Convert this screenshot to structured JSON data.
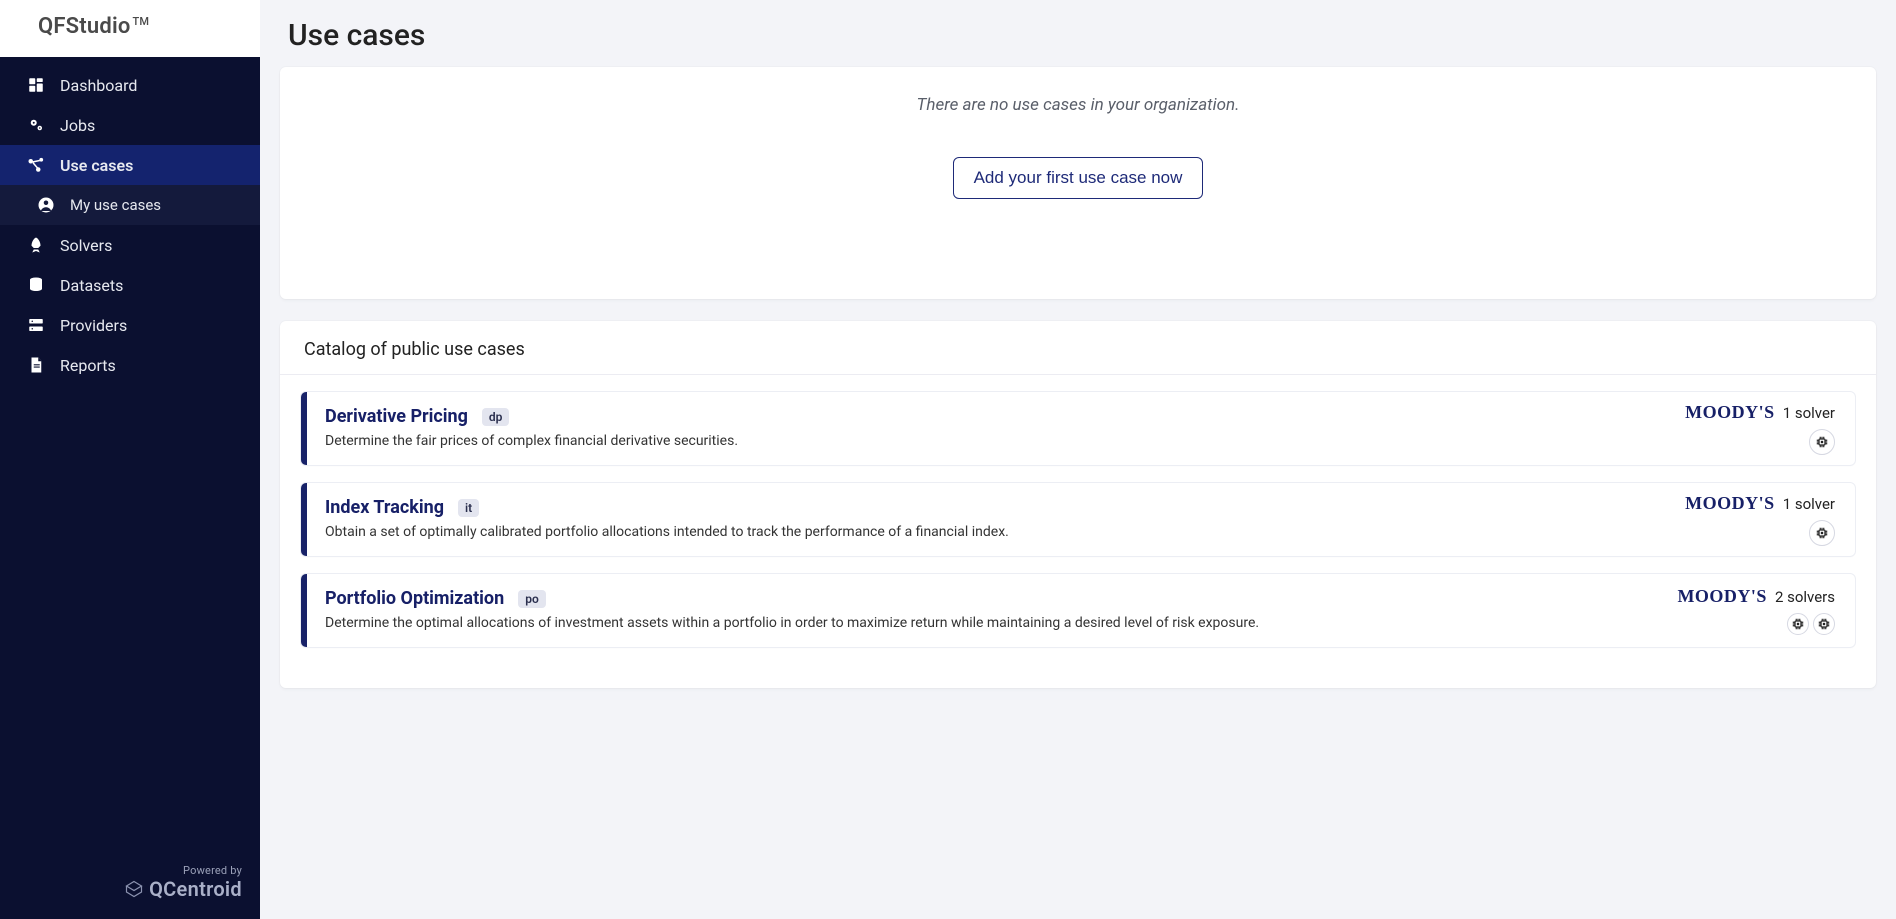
{
  "brand": {
    "name": "QFStudio",
    "tm": "TM"
  },
  "sidebar": {
    "items": [
      {
        "label": "Dashboard"
      },
      {
        "label": "Jobs"
      },
      {
        "label": "Use cases"
      },
      {
        "label": "Solvers"
      },
      {
        "label": "Datasets"
      },
      {
        "label": "Providers"
      },
      {
        "label": "Reports"
      }
    ],
    "sub": {
      "my_use_cases": "My use cases"
    }
  },
  "footer": {
    "powered": "Powered by",
    "brand": "QCentroid"
  },
  "page_title": "Use cases",
  "empty_card": {
    "message": "There are no use cases in your organization.",
    "button": "Add your first use case now"
  },
  "catalog": {
    "title": "Catalog of public use cases",
    "items": [
      {
        "title": "Derivative Pricing",
        "tag": "dp",
        "desc": "Determine the fair prices of complex financial derivative securities.",
        "provider": "MOODY'S",
        "solvers_label": "1 solver",
        "solver_count": 1
      },
      {
        "title": "Index Tracking",
        "tag": "it",
        "desc": "Obtain a set of optimally calibrated portfolio allocations intended to track the performance of a financial index.",
        "provider": "MOODY'S",
        "solvers_label": "1 solver",
        "solver_count": 1
      },
      {
        "title": "Portfolio Optimization",
        "tag": "po",
        "desc": "Determine the optimal allocations of investment assets within a portfolio in order to maximize return while maintaining a desired level of risk exposure.",
        "provider": "MOODY'S",
        "solvers_label": "2 solvers",
        "solver_count": 2
      }
    ]
  }
}
